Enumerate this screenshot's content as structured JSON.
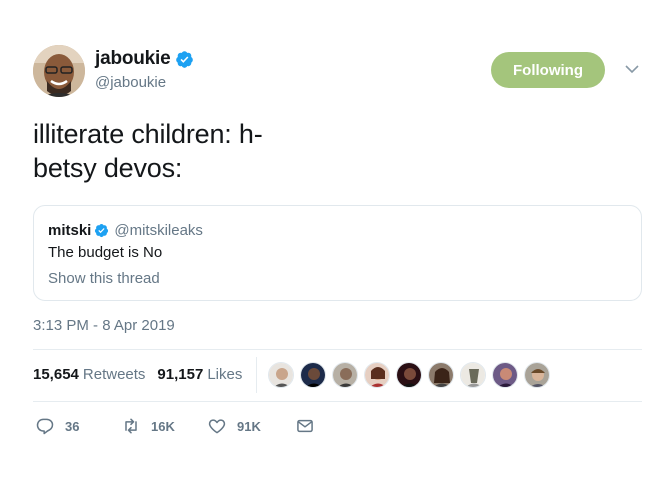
{
  "user": {
    "display_name": "jaboukie",
    "handle": "@jaboukie",
    "verified": true,
    "follow_label": "Following"
  },
  "tweet": {
    "text": "illiterate children: h-\nbetsy devos:",
    "timestamp": "3:13 PM - 8 Apr 2019"
  },
  "quote": {
    "display_name": "mitski",
    "handle": "@mitskileaks",
    "verified": true,
    "text": "The budget is No",
    "show_thread": "Show this thread"
  },
  "stats": {
    "retweets_count": "15,654",
    "retweets_label": "Retweets",
    "likes_count": "91,157",
    "likes_label": "Likes"
  },
  "actions": {
    "reply_count": "36",
    "retweet_count": "16K",
    "like_count": "91K"
  },
  "colors": {
    "follow_button": "#a4c57c",
    "verified_blue": "#1da1f2",
    "secondary_text": "#657786"
  },
  "icons": [
    "verified-badge-icon",
    "chevron-down-icon",
    "reply-icon",
    "retweet-icon",
    "like-icon",
    "message-icon"
  ]
}
